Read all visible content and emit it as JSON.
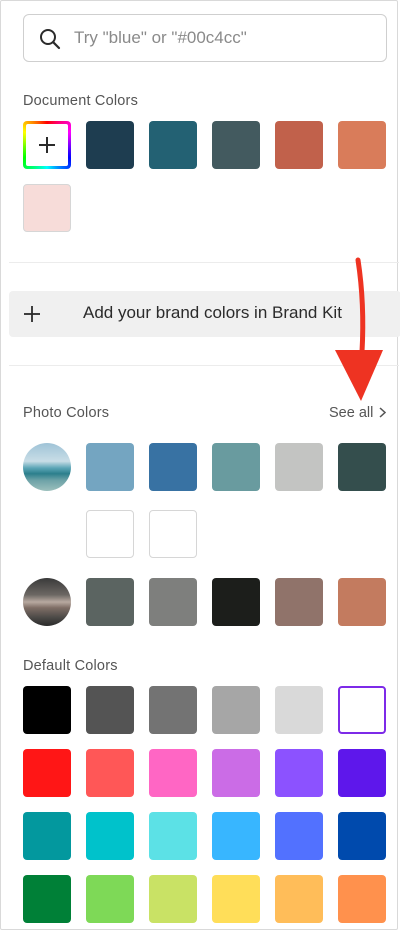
{
  "search": {
    "placeholder": "Try \"blue\" or \"#00c4cc\""
  },
  "document_colors": {
    "title": "Document Colors",
    "swatches": [
      "#1e3d50",
      "#236173",
      "#435a5f",
      "#c1614b",
      "#d97c5a",
      "#f7dcd9"
    ]
  },
  "brand": {
    "label": "Add your brand colors in Brand Kit"
  },
  "photo_colors": {
    "title": "Photo Colors",
    "see_all": "See all",
    "photo1_swatches": [
      "#74a5c1",
      "#3872a3",
      "#699b9f",
      "#c3c4c2",
      "#344e4d",
      "#ffffff",
      "#ffffff"
    ],
    "photo2_swatches": [
      "#5b6461",
      "#7e7f7d",
      "#1c1e1b",
      "#90736a",
      "#c37b5f"
    ]
  },
  "default_colors": {
    "title": "Default Colors",
    "rows": [
      [
        "#000000",
        "#545454",
        "#737373",
        "#a6a6a6",
        "#d9d9d9",
        "#ffffff"
      ],
      [
        "#ff1616",
        "#ff5757",
        "#ff66c4",
        "#cb6ce6",
        "#8c52ff",
        "#5e17eb"
      ],
      [
        "#03989e",
        "#00c2cb",
        "#5ce1e6",
        "#38b6ff",
        "#5271ff",
        "#004aad"
      ],
      [
        "#008037",
        "#7ed957",
        "#c9e265",
        "#ffde59",
        "#ffbd59",
        "#ff914d"
      ]
    ],
    "selected_color": "#ffffff",
    "selected_accent": "#7d2ae8"
  },
  "icons": {
    "search": "search-icon",
    "add_color": "plus-icon",
    "brand_add": "plus-icon",
    "see_all": "chevron-right-icon",
    "annotation": "red-arrow-icon"
  },
  "annotation_color": "#ee3322"
}
